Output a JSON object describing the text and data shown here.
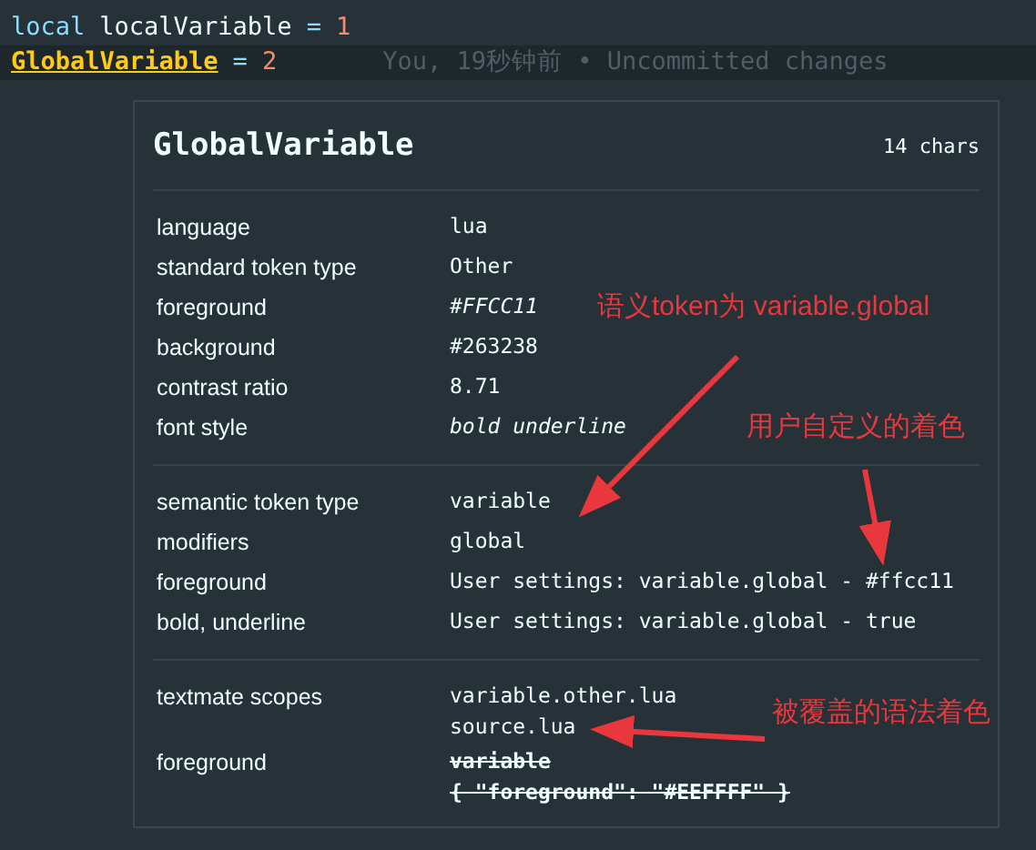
{
  "code_lines": [
    {
      "current": false,
      "tokens": [
        {
          "text": "local",
          "kind": "keyword"
        },
        {
          "text": "localVariable",
          "kind": "local"
        },
        {
          "text": "=",
          "kind": "operator"
        },
        {
          "text": "1",
          "kind": "number"
        }
      ]
    },
    {
      "current": true,
      "blame": "You, 19秒钟前 • Uncommitted changes",
      "tokens": [
        {
          "text": "GlobalVariable",
          "kind": "global"
        },
        {
          "text": "=",
          "kind": "operator"
        },
        {
          "text": "2",
          "kind": "number"
        }
      ]
    }
  ],
  "hover": {
    "title": "GlobalVariable",
    "length": "14 chars",
    "sections": [
      {
        "rows": [
          {
            "label": "language",
            "value": [
              "lua"
            ],
            "kind": "text"
          },
          {
            "label": "standard token type",
            "value": [
              "Other"
            ],
            "kind": "text"
          },
          {
            "label": "foreground",
            "value": [
              "#FFCC11"
            ],
            "kind": "color"
          },
          {
            "label": "background",
            "value": [
              "#263238"
            ],
            "kind": "text"
          },
          {
            "label": "contrast ratio",
            "value": [
              "8.71"
            ],
            "kind": "text"
          },
          {
            "label": "font style",
            "value": [
              "bold underline"
            ],
            "kind": "fontstyle"
          }
        ]
      },
      {
        "rows": [
          {
            "label": "semantic token type",
            "value": [
              "variable"
            ],
            "kind": "text"
          },
          {
            "label": "modifiers",
            "value": [
              "global"
            ],
            "kind": "text"
          },
          {
            "label": "foreground",
            "value": [
              "User settings: variable.global - #ffcc11"
            ],
            "kind": "text"
          },
          {
            "label": "bold, underline",
            "value": [
              "User settings: variable.global - true"
            ],
            "kind": "text"
          }
        ]
      },
      {
        "rows": [
          {
            "label": "textmate scopes",
            "value": [
              "variable.other.lua",
              "source.lua"
            ],
            "kind": "text"
          },
          {
            "label": "foreground",
            "value": [
              "variable",
              "{ \"foreground\": \"#EEFFFF\" }"
            ],
            "kind": "overridden"
          }
        ]
      }
    ]
  },
  "annotations": [
    {
      "text": "语义token为 variable.global"
    },
    {
      "text": "用户自定义的着色"
    },
    {
      "text": "被覆盖的语法着色"
    }
  ]
}
